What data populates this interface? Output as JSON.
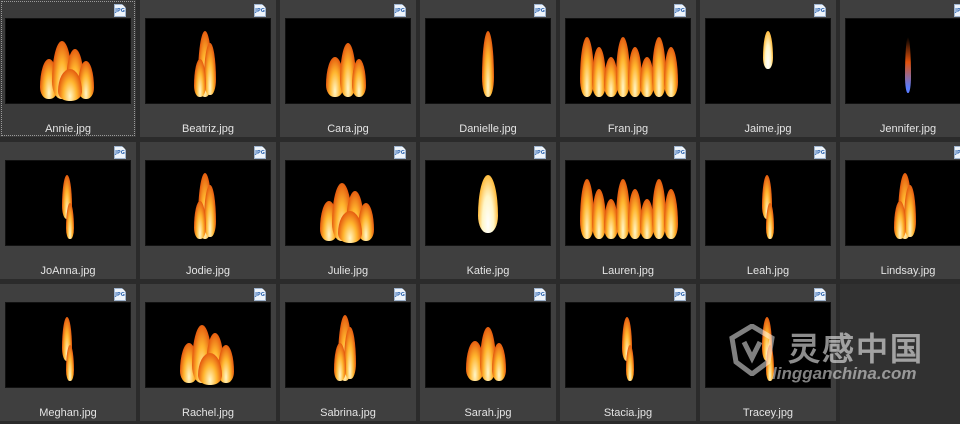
{
  "files": [
    {
      "name": "Annie.jpg",
      "selected": true,
      "flame": "wide"
    },
    {
      "name": "Beatriz.jpg",
      "selected": false,
      "flame": "tall"
    },
    {
      "name": "Cara.jpg",
      "selected": false,
      "flame": "mid"
    },
    {
      "name": "Danielle.jpg",
      "selected": false,
      "flame": "thin"
    },
    {
      "name": "Fran.jpg",
      "selected": false,
      "flame": "wall"
    },
    {
      "name": "Jaime.jpg",
      "selected": false,
      "flame": "candle"
    },
    {
      "name": "Jennifer.jpg",
      "selected": false,
      "flame": "blue"
    },
    {
      "name": "JoAnna.jpg",
      "selected": false,
      "flame": "wisp"
    },
    {
      "name": "Jodie.jpg",
      "selected": false,
      "flame": "tall"
    },
    {
      "name": "Julie.jpg",
      "selected": false,
      "flame": "wide"
    },
    {
      "name": "Katie.jpg",
      "selected": false,
      "flame": "candle-big"
    },
    {
      "name": "Lauren.jpg",
      "selected": false,
      "flame": "wall"
    },
    {
      "name": "Leah.jpg",
      "selected": false,
      "flame": "wisp"
    },
    {
      "name": "Lindsay.jpg",
      "selected": false,
      "flame": "tall"
    },
    {
      "name": "Meghan.jpg",
      "selected": false,
      "flame": "wisp"
    },
    {
      "name": "Rachel.jpg",
      "selected": false,
      "flame": "wide"
    },
    {
      "name": "Sabrina.jpg",
      "selected": false,
      "flame": "tall"
    },
    {
      "name": "Sarah.jpg",
      "selected": false,
      "flame": "mid"
    },
    {
      "name": "Stacia.jpg",
      "selected": false,
      "flame": "wisp"
    },
    {
      "name": "Tracey.jpg",
      "selected": false,
      "flame": "wisp"
    }
  ],
  "file_type_badge": "JPG",
  "flame_colors": {
    "core": "#fff6c8",
    "mid": "#ffb52e",
    "outer": "#e2520c",
    "blue": "#5a7cff"
  },
  "watermark": {
    "title": "灵感中国",
    "subtitle": "lingganchina.com"
  }
}
